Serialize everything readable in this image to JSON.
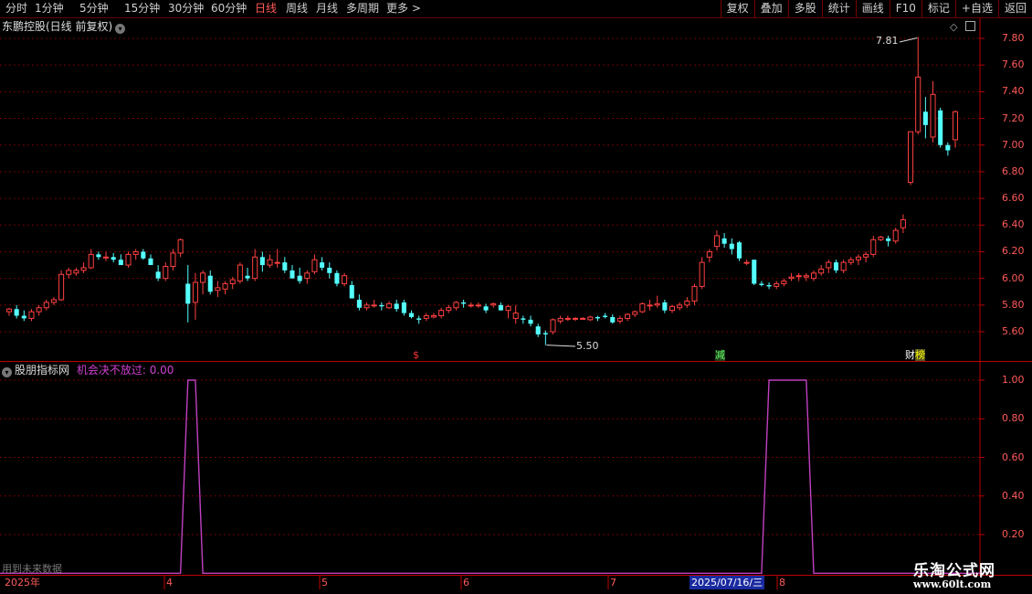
{
  "toolbar": {
    "periods": [
      "分时",
      "1分钟",
      "5分钟",
      "15分钟",
      "30分钟",
      "60分钟",
      "日线",
      "周线",
      "月线",
      "多周期",
      "更多 >"
    ],
    "active_period": "日线",
    "buttons": [
      "复权",
      "叠加",
      "多股",
      "统计",
      "画线",
      "F10",
      "标记",
      "+自选",
      "返回"
    ]
  },
  "main_panel": {
    "title": "东鹏控股(日线 前复权)",
    "high_label": "7.81",
    "low_label": "5.50",
    "y_ticks": [
      "7.80",
      "7.60",
      "7.40",
      "7.20",
      "7.00",
      "6.80",
      "6.60",
      "6.40",
      "6.20",
      "6.00",
      "5.80",
      "5.60"
    ],
    "markers": [
      {
        "text": "$",
        "color": "#ff3030"
      },
      {
        "text": "减",
        "color": "#6f6"
      },
      {
        "text": "财",
        "color": "#fff"
      },
      {
        "text": "榜",
        "color": "#ff0"
      }
    ]
  },
  "indicator_panel": {
    "title": "股朋指标网",
    "value_label": "机会决不放过: 0.00",
    "y_ticks": [
      "1.00",
      "0.80",
      "0.60",
      "0.40",
      "0.20"
    ],
    "future_note": "用到未来数据"
  },
  "x_axis": {
    "labels": [
      "2025年",
      "4",
      "5",
      "6",
      "7",
      "8"
    ],
    "cursor_date": "2025/07/16/三"
  },
  "watermark": {
    "title": "乐淘公式网",
    "url": "www.60lt.com"
  },
  "colors": {
    "up": "#ff4040",
    "down": "#54ffff",
    "grid": "#700000",
    "indicator_line": "#c040c0"
  },
  "chart_data": {
    "type": "candlestick",
    "price_range": [
      5.45,
      7.9
    ],
    "candles_ohlc": [
      [
        5.75,
        5.78,
        5.72,
        5.77
      ],
      [
        5.77,
        5.8,
        5.7,
        5.72
      ],
      [
        5.72,
        5.76,
        5.68,
        5.7
      ],
      [
        5.7,
        5.77,
        5.68,
        5.75
      ],
      [
        5.75,
        5.8,
        5.72,
        5.78
      ],
      [
        5.78,
        5.84,
        5.76,
        5.82
      ],
      [
        5.82,
        5.86,
        5.8,
        5.84
      ],
      [
        5.84,
        6.06,
        5.83,
        6.03
      ],
      [
        6.03,
        6.08,
        6.0,
        6.06
      ],
      [
        6.04,
        6.08,
        6.02,
        6.06
      ],
      [
        6.06,
        6.12,
        6.04,
        6.08
      ],
      [
        6.08,
        6.22,
        6.07,
        6.18
      ],
      [
        6.18,
        6.2,
        6.14,
        6.16
      ],
      [
        6.16,
        6.2,
        6.13,
        6.16
      ],
      [
        6.16,
        6.19,
        6.12,
        6.14
      ],
      [
        6.14,
        6.18,
        6.1,
        6.1
      ],
      [
        6.1,
        6.2,
        6.08,
        6.18
      ],
      [
        6.18,
        6.22,
        6.14,
        6.2
      ],
      [
        6.2,
        6.22,
        6.14,
        6.15
      ],
      [
        6.15,
        6.18,
        6.1,
        6.1
      ],
      [
        6.05,
        6.1,
        5.98,
        6.0
      ],
      [
        6.0,
        6.12,
        5.98,
        6.09
      ],
      [
        6.09,
        6.22,
        6.06,
        6.19
      ],
      [
        6.19,
        6.3,
        6.16,
        6.29
      ],
      [
        5.96,
        6.1,
        5.67,
        5.81
      ],
      [
        5.82,
        6.04,
        5.69,
        5.97
      ],
      [
        5.97,
        6.06,
        5.88,
        6.04
      ],
      [
        6.02,
        6.06,
        5.88,
        5.9
      ],
      [
        5.91,
        5.98,
        5.86,
        5.93
      ],
      [
        5.92,
        5.98,
        5.88,
        5.96
      ],
      [
        5.96,
        6.01,
        5.92,
        5.99
      ],
      [
        5.98,
        6.12,
        5.96,
        6.1
      ],
      [
        6.02,
        6.08,
        5.98,
        6.0
      ],
      [
        6.0,
        6.22,
        5.98,
        6.16
      ],
      [
        6.16,
        6.2,
        6.05,
        6.1
      ],
      [
        6.1,
        6.18,
        6.08,
        6.14
      ],
      [
        6.12,
        6.22,
        6.08,
        6.12
      ],
      [
        6.12,
        6.16,
        6.04,
        6.06
      ],
      [
        6.06,
        6.1,
        6.0,
        6.0
      ],
      [
        6.02,
        6.08,
        5.96,
        5.98
      ],
      [
        6.0,
        6.06,
        5.96,
        6.04
      ],
      [
        6.05,
        6.18,
        6.03,
        6.14
      ],
      [
        6.12,
        6.16,
        6.06,
        6.08
      ],
      [
        6.08,
        6.12,
        6.0,
        6.04
      ],
      [
        6.04,
        6.06,
        5.94,
        5.96
      ],
      [
        5.96,
        6.04,
        5.94,
        6.02
      ],
      [
        5.95,
        5.98,
        5.85,
        5.85
      ],
      [
        5.84,
        5.88,
        5.76,
        5.78
      ],
      [
        5.78,
        5.82,
        5.76,
        5.8
      ],
      [
        5.8,
        5.84,
        5.78,
        5.8
      ],
      [
        5.8,
        5.82,
        5.76,
        5.79
      ],
      [
        5.78,
        5.83,
        5.77,
        5.81
      ],
      [
        5.81,
        5.84,
        5.75,
        5.77
      ],
      [
        5.82,
        5.84,
        5.72,
        5.74
      ],
      [
        5.74,
        5.76,
        5.7,
        5.71
      ],
      [
        5.7,
        5.72,
        5.66,
        5.69
      ],
      [
        5.7,
        5.74,
        5.68,
        5.72
      ],
      [
        5.71,
        5.74,
        5.7,
        5.72
      ],
      [
        5.72,
        5.78,
        5.7,
        5.76
      ],
      [
        5.76,
        5.8,
        5.74,
        5.78
      ],
      [
        5.78,
        5.83,
        5.76,
        5.82
      ],
      [
        5.82,
        5.84,
        5.78,
        5.81
      ],
      [
        5.8,
        5.82,
        5.78,
        5.8
      ],
      [
        5.8,
        5.82,
        5.78,
        5.8
      ],
      [
        5.79,
        5.81,
        5.74,
        5.76
      ],
      [
        5.8,
        5.82,
        5.78,
        5.81
      ],
      [
        5.8,
        5.82,
        5.76,
        5.76
      ],
      [
        5.76,
        5.8,
        5.7,
        5.79
      ],
      [
        5.7,
        5.8,
        5.66,
        5.74
      ],
      [
        5.7,
        5.72,
        5.66,
        5.69
      ],
      [
        5.69,
        5.72,
        5.64,
        5.66
      ],
      [
        5.64,
        5.66,
        5.56,
        5.58
      ],
      [
        5.59,
        5.61,
        5.5,
        5.58
      ],
      [
        5.6,
        5.7,
        5.58,
        5.69
      ],
      [
        5.68,
        5.72,
        5.66,
        5.7
      ],
      [
        5.7,
        5.72,
        5.68,
        5.7
      ],
      [
        5.7,
        5.71,
        5.68,
        5.7
      ],
      [
        5.7,
        5.71,
        5.69,
        5.7
      ],
      [
        5.69,
        5.72,
        5.68,
        5.71
      ],
      [
        5.71,
        5.72,
        5.68,
        5.7
      ],
      [
        5.72,
        5.74,
        5.7,
        5.71
      ],
      [
        5.71,
        5.73,
        5.66,
        5.67
      ],
      [
        5.68,
        5.72,
        5.66,
        5.7
      ],
      [
        5.7,
        5.74,
        5.68,
        5.73
      ],
      [
        5.73,
        5.76,
        5.71,
        5.75
      ],
      [
        5.75,
        5.82,
        5.74,
        5.81
      ],
      [
        5.8,
        5.84,
        5.76,
        5.8
      ],
      [
        5.8,
        5.87,
        5.78,
        5.81
      ],
      [
        5.82,
        5.84,
        5.74,
        5.76
      ],
      [
        5.76,
        5.8,
        5.74,
        5.79
      ],
      [
        5.78,
        5.82,
        5.76,
        5.8
      ],
      [
        5.8,
        5.86,
        5.78,
        5.83
      ],
      [
        5.83,
        5.96,
        5.8,
        5.94
      ],
      [
        5.94,
        6.16,
        5.92,
        6.12
      ],
      [
        6.16,
        6.22,
        6.12,
        6.2
      ],
      [
        6.24,
        6.36,
        6.21,
        6.32
      ],
      [
        6.3,
        6.34,
        6.23,
        6.26
      ],
      [
        6.26,
        6.3,
        6.18,
        6.22
      ],
      [
        6.27,
        6.28,
        6.13,
        6.15
      ],
      [
        6.12,
        6.14,
        6.1,
        6.12
      ],
      [
        6.14,
        6.14,
        5.95,
        5.96
      ],
      [
        5.96,
        5.98,
        5.94,
        5.95
      ],
      [
        5.95,
        5.97,
        5.92,
        5.94
      ],
      [
        5.94,
        5.98,
        5.92,
        5.96
      ],
      [
        5.96,
        6.0,
        5.94,
        5.98
      ],
      [
        6.0,
        6.04,
        5.98,
        6.01
      ],
      [
        6.02,
        6.04,
        5.98,
        6.02
      ],
      [
        6.01,
        6.04,
        5.98,
        6.02
      ],
      [
        6.0,
        6.06,
        5.98,
        6.04
      ],
      [
        6.04,
        6.1,
        6.02,
        6.07
      ],
      [
        6.08,
        6.14,
        6.04,
        6.12
      ],
      [
        6.12,
        6.14,
        6.04,
        6.06
      ],
      [
        6.06,
        6.14,
        6.04,
        6.12
      ],
      [
        6.12,
        6.16,
        6.1,
        6.14
      ],
      [
        6.14,
        6.18,
        6.1,
        6.16
      ],
      [
        6.16,
        6.2,
        6.12,
        6.18
      ],
      [
        6.18,
        6.32,
        6.16,
        6.29
      ],
      [
        6.29,
        6.32,
        6.28,
        6.31
      ],
      [
        6.3,
        6.32,
        6.24,
        6.28
      ],
      [
        6.28,
        6.38,
        6.26,
        6.36
      ],
      [
        6.38,
        6.48,
        6.34,
        6.44
      ],
      [
        6.72,
        7.1,
        6.7,
        7.1
      ],
      [
        7.1,
        7.81,
        7.08,
        7.51
      ],
      [
        7.25,
        7.36,
        7.05,
        7.15
      ],
      [
        7.06,
        7.48,
        7.02,
        7.38
      ],
      [
        7.26,
        7.28,
        6.98,
        7.0
      ],
      [
        7.0,
        7.02,
        6.92,
        6.96
      ],
      [
        7.04,
        7.26,
        6.98,
        7.25
      ]
    ],
    "indicator": {
      "name": "机会决不放过",
      "range": [
        0,
        1
      ],
      "pulses_index": [
        24,
        25,
        102,
        103,
        104,
        105,
        106,
        107
      ],
      "pulse_width": 1
    }
  }
}
